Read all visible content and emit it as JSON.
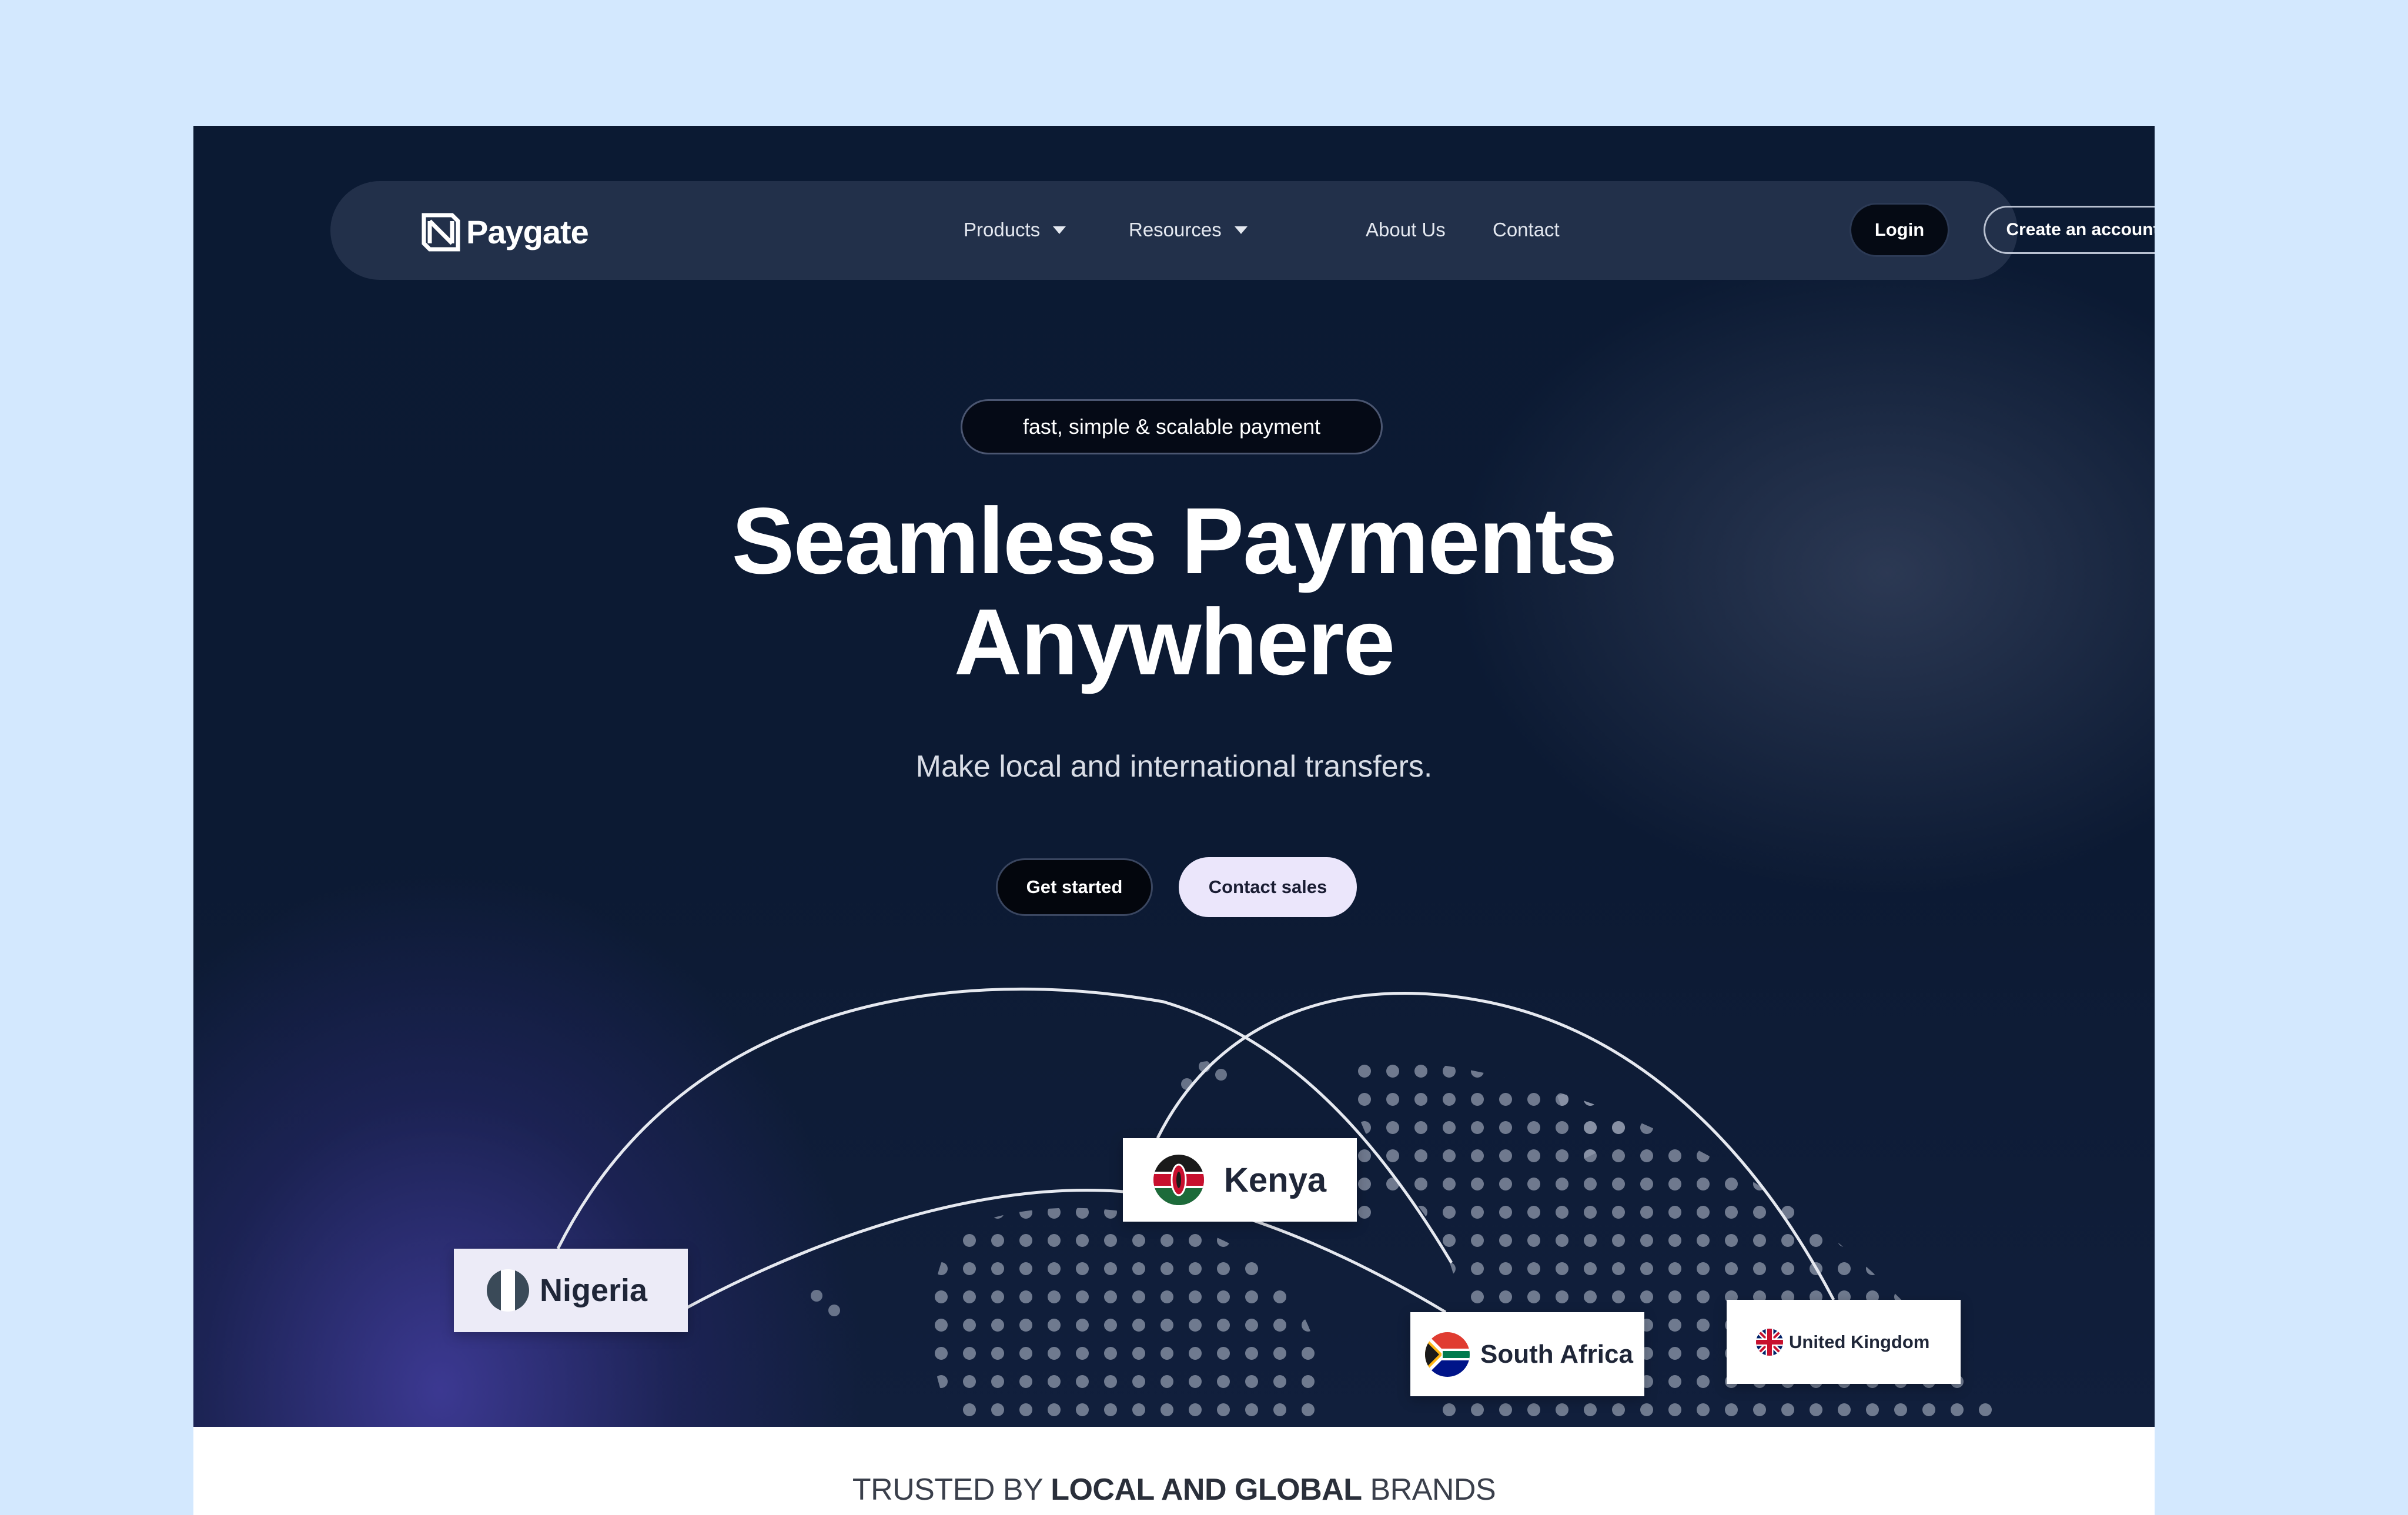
{
  "brand": {
    "name": "Paygate"
  },
  "nav": {
    "products": "Products",
    "resources": "Resources",
    "about": "About Us",
    "contact": "Contact",
    "login": "Login",
    "create_account": "Create an account"
  },
  "hero": {
    "badge": "fast, simple & scalable payment",
    "headline_line1": "Seamless Payments",
    "headline_line2": "Anywhere",
    "subheadline": "Make local and international transfers.",
    "cta_primary": "Get started",
    "cta_secondary": "Contact sales"
  },
  "countries": {
    "nigeria": "Nigeria",
    "kenya": "Kenya",
    "south_africa": "South Africa",
    "united_kingdom": "United Kingdom"
  },
  "trusted": {
    "prefix": "TRUSTED BY",
    "emphasis": "LOCAL AND GLOBAL",
    "suffix": "BRANDS"
  },
  "colors": {
    "page_background": "#d3e8fe",
    "hero_background": "#0b1a33",
    "nav_background": "#22304a",
    "secondary_button": "#ebe6fb"
  }
}
